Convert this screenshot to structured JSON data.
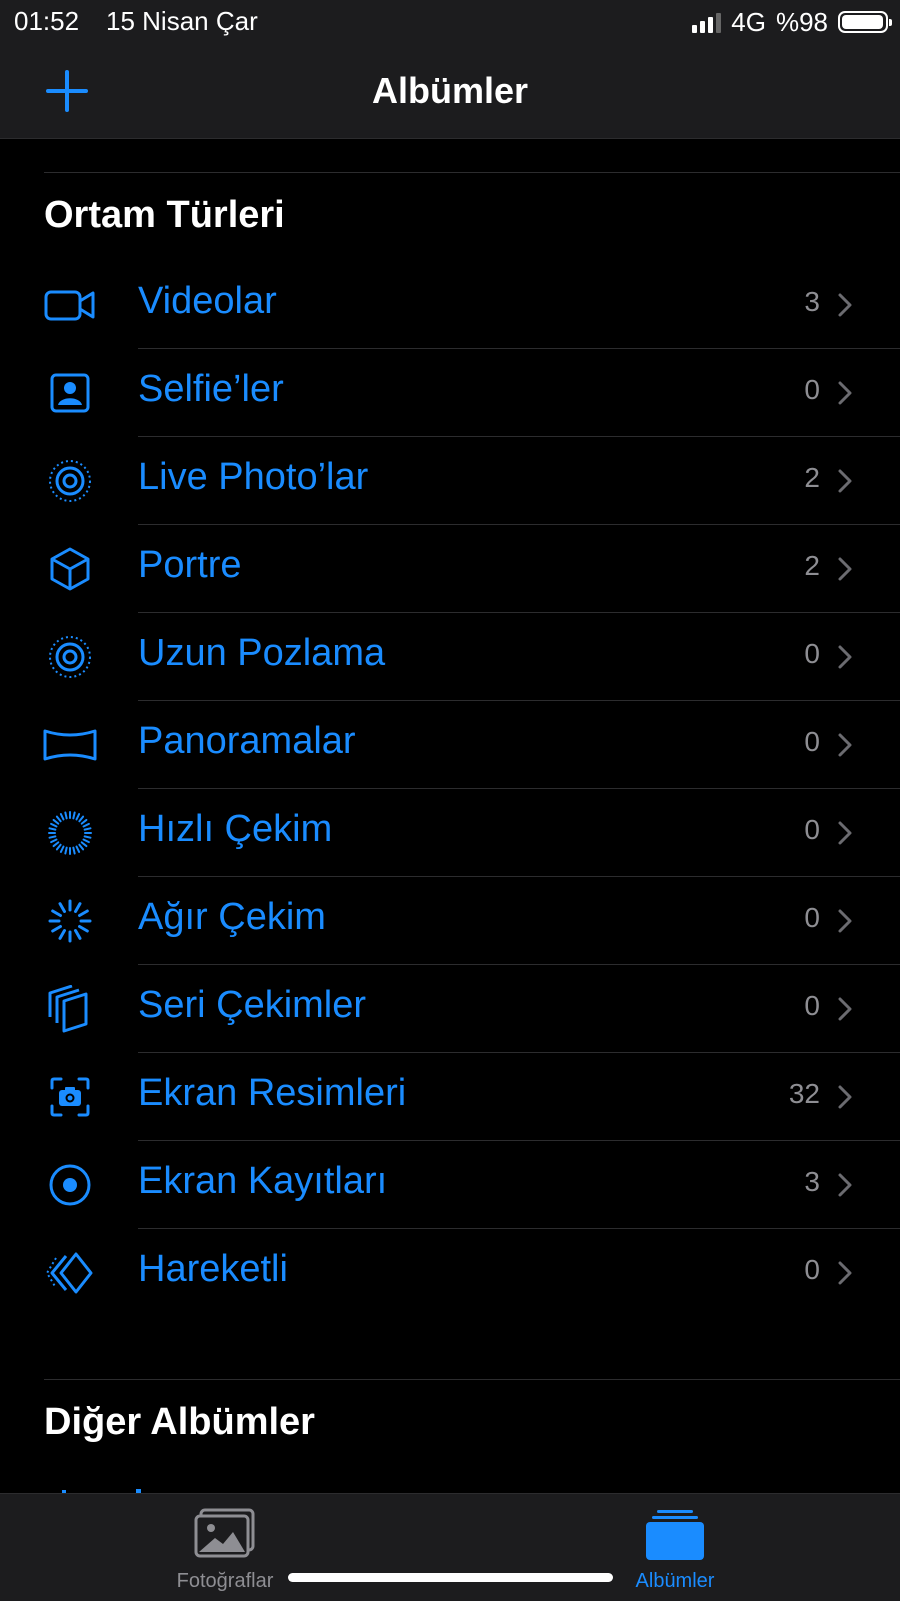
{
  "status_bar": {
    "time": "01:52",
    "date": "15 Nisan Çar",
    "network": "4G",
    "battery_text": "%98",
    "battery_level": 0.98,
    "signal_bars_filled": 3,
    "signal_bars_total": 4
  },
  "nav": {
    "title": "Albümler",
    "add_icon": "plus-icon"
  },
  "sections": {
    "media_types": {
      "title": "Ortam Türleri",
      "items": [
        {
          "label": "Videolar",
          "count": "3",
          "icon": "video-camera-icon"
        },
        {
          "label": "Selfie’ler",
          "count": "0",
          "icon": "selfie-portrait-icon"
        },
        {
          "label": "Live Photo’lar",
          "count": "2",
          "icon": "live-photo-icon"
        },
        {
          "label": "Portre",
          "count": "2",
          "icon": "cube-icon"
        },
        {
          "label": "Uzun Pozlama",
          "count": "0",
          "icon": "long-exposure-icon"
        },
        {
          "label": "Panoramalar",
          "count": "0",
          "icon": "panorama-icon"
        },
        {
          "label": "Hızlı Çekim",
          "count": "0",
          "icon": "timelapse-icon"
        },
        {
          "label": "Ağır Çekim",
          "count": "0",
          "icon": "slow-motion-icon"
        },
        {
          "label": "Seri Çekimler",
          "count": "0",
          "icon": "burst-icon"
        },
        {
          "label": "Ekran Resimleri",
          "count": "32",
          "icon": "screenshot-icon"
        },
        {
          "label": "Ekran Kayıtları",
          "count": "3",
          "icon": "screen-recording-icon"
        },
        {
          "label": "Hareketli",
          "count": "0",
          "icon": "animated-icon"
        }
      ]
    },
    "other_albums": {
      "title": "Diğer Albümler"
    }
  },
  "tabbar": {
    "tabs": [
      {
        "label": "Fotoğraflar",
        "icon": "photos-icon",
        "active": false
      },
      {
        "label": "Albümler",
        "icon": "albums-icon",
        "active": true
      }
    ]
  },
  "colors": {
    "accent": "#1a8cff",
    "background": "#000000",
    "bar_background": "#1c1c1e",
    "secondary_text": "#8e8e93",
    "inactive_tab": "#8e8e93"
  }
}
